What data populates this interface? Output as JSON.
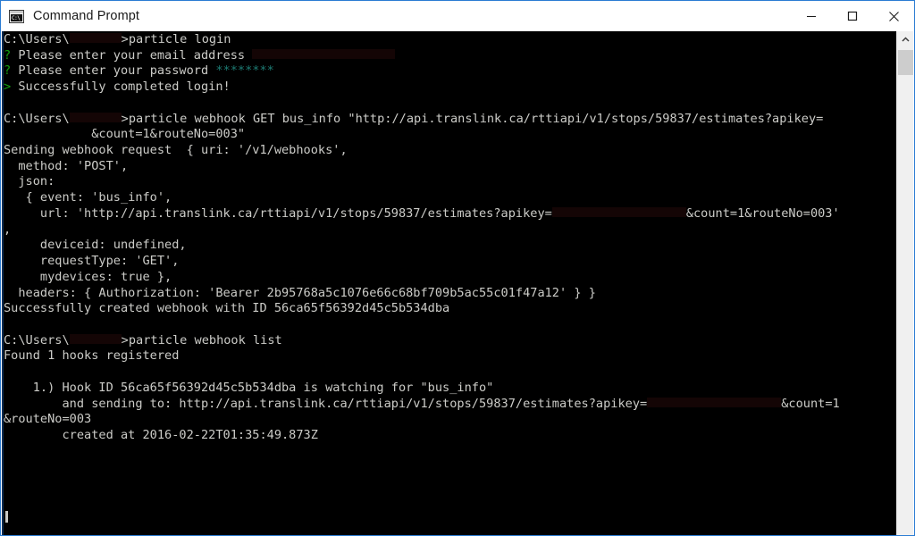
{
  "window": {
    "title": "Command Prompt",
    "icon": "command-prompt-icon",
    "icon_glyph": "C:\\",
    "controls": {
      "minimize": "Minimize",
      "maximize": "Maximize",
      "close": "Close"
    },
    "accent_border": "#2b7cd3",
    "titlebar_bg": "#ffffff",
    "console_bg": "#000000",
    "console_fg": "#ccccc8",
    "prompt_color": "#13a10e",
    "password_color": "#1d7c74"
  },
  "scrollbar": {
    "up_arrow": "scroll-up-arrow",
    "thumb": "scroll-thumb",
    "track": "scroll-track"
  },
  "console": {
    "lines": [
      {
        "id": "l01",
        "segments": [
          {
            "text": "C:\\Users\\",
            "color": "txt"
          },
          {
            "redact": 58
          },
          {
            "text": ">particle login",
            "color": "txt"
          }
        ]
      },
      {
        "id": "l02",
        "segments": [
          {
            "text": "? ",
            "color": "prompt"
          },
          {
            "text": "Please enter your email address ",
            "color": "txt"
          },
          {
            "redact": 160
          }
        ]
      },
      {
        "id": "l03",
        "segments": [
          {
            "text": "? ",
            "color": "prompt"
          },
          {
            "text": "Please enter your password ",
            "color": "txt"
          },
          {
            "text": "********",
            "color": "cyan"
          }
        ]
      },
      {
        "id": "l04",
        "segments": [
          {
            "text": "> ",
            "color": "prompt"
          },
          {
            "text": "Successfully completed login!",
            "color": "txt"
          }
        ]
      },
      {
        "id": "l05",
        "blank": true
      },
      {
        "id": "l06",
        "segments": [
          {
            "text": "C:\\Users\\",
            "color": "txt"
          },
          {
            "redact": 58
          },
          {
            "text": ">particle webhook GET bus_info \"http://api.translink.ca/rttiapi/v1/stops/59837/estimates?apikey=",
            "color": "txt"
          }
        ]
      },
      {
        "id": "l07",
        "segments": [
          {
            "text": "            &count=1&routeNo=003\"",
            "color": "txt"
          }
        ]
      },
      {
        "id": "l08",
        "segments": [
          {
            "text": "Sending webhook request  { uri: '/v1/webhooks',",
            "color": "txt"
          }
        ]
      },
      {
        "id": "l09",
        "segments": [
          {
            "text": "  method: 'POST',",
            "color": "txt"
          }
        ]
      },
      {
        "id": "l10",
        "segments": [
          {
            "text": "  json:",
            "color": "txt"
          }
        ]
      },
      {
        "id": "l11",
        "segments": [
          {
            "text": "   { event: 'bus_info',",
            "color": "txt"
          }
        ]
      },
      {
        "id": "l12",
        "segments": [
          {
            "text": "     url: 'http://api.translink.ca/rttiapi/v1/stops/59837/estimates?apikey=",
            "color": "txt"
          },
          {
            "redact": 150
          },
          {
            "text": "&count=1&routeNo=003'",
            "color": "txt"
          }
        ]
      },
      {
        "id": "l13",
        "segments": [
          {
            "text": ",",
            "color": "txt"
          }
        ]
      },
      {
        "id": "l14",
        "segments": [
          {
            "text": "     deviceid: undefined,",
            "color": "txt"
          }
        ]
      },
      {
        "id": "l15",
        "segments": [
          {
            "text": "     requestType: 'GET',",
            "color": "txt"
          }
        ]
      },
      {
        "id": "l16",
        "segments": [
          {
            "text": "     mydevices: true },",
            "color": "txt"
          }
        ]
      },
      {
        "id": "l17",
        "segments": [
          {
            "text": "  headers: { Authorization: 'Bearer 2b95768a5c1076e66c68bf709b5ac55c01f47a12' } }",
            "color": "txt"
          }
        ]
      },
      {
        "id": "l18",
        "segments": [
          {
            "text": "Successfully created webhook with ID 56ca65f56392d45c5b534dba",
            "color": "txt"
          }
        ]
      },
      {
        "id": "l19",
        "blank": true
      },
      {
        "id": "l20",
        "segments": [
          {
            "text": "C:\\Users\\",
            "color": "txt"
          },
          {
            "redact": 58
          },
          {
            "text": ">particle webhook list",
            "color": "txt"
          }
        ]
      },
      {
        "id": "l21",
        "segments": [
          {
            "text": "Found 1 hooks registered",
            "color": "txt"
          }
        ]
      },
      {
        "id": "l22",
        "blank": true
      },
      {
        "id": "l23",
        "segments": [
          {
            "text": "    1.) Hook ID 56ca65f56392d45c5b534dba is watching for \"bus_info\"",
            "color": "txt"
          }
        ]
      },
      {
        "id": "l24",
        "segments": [
          {
            "text": "        and sending to: http://api.translink.ca/rttiapi/v1/stops/59837/estimates?apikey=",
            "color": "txt"
          },
          {
            "redact": 150
          },
          {
            "text": "&count=1",
            "color": "txt"
          }
        ]
      },
      {
        "id": "l25",
        "segments": [
          {
            "text": "&routeNo=003",
            "color": "txt"
          }
        ]
      },
      {
        "id": "l26",
        "segments": [
          {
            "text": "        created at 2016-02-22T01:35:49.873Z",
            "color": "txt"
          }
        ]
      }
    ],
    "cursor": "block-caret"
  }
}
